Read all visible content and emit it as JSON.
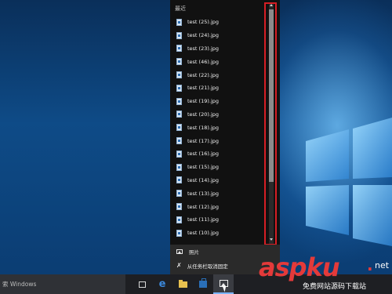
{
  "taskbar": {
    "search_text": "索 Windows",
    "buttons": [
      {
        "name": "task-view-button",
        "icon": "task-view-icon"
      },
      {
        "name": "edge-button",
        "icon": "edge-icon"
      },
      {
        "name": "file-explorer-button",
        "icon": "folder-icon"
      },
      {
        "name": "store-button",
        "icon": "store-icon"
      },
      {
        "name": "photos-button",
        "icon": "photos-icon"
      }
    ]
  },
  "jumplist": {
    "section_title": "最近",
    "items": [
      "test (25).jpg",
      "test (24).jpg",
      "test (23).jpg",
      "test (46).jpg",
      "test (22).jpg",
      "test (21).jpg",
      "test (19).jpg",
      "test (20).jpg",
      "test (18).jpg",
      "test (17).jpg",
      "test (16).jpg",
      "test (15).jpg",
      "test (14).jpg",
      "test (13).jpg",
      "test (12).jpg",
      "test (11).jpg",
      "test (10).jpg"
    ],
    "footer": {
      "app_label": "照片",
      "unpin_label": "从任务栏取消固定"
    }
  },
  "watermark": {
    "brand": "aspku",
    "dot": ".",
    "tld": "net",
    "subtitle": "免费网站源码下载站"
  },
  "colors": {
    "highlight": "#d61e24",
    "jumplist_bg": "#111111",
    "taskbar_bg": "#1e1f23",
    "watermark": "#e43a3a"
  }
}
